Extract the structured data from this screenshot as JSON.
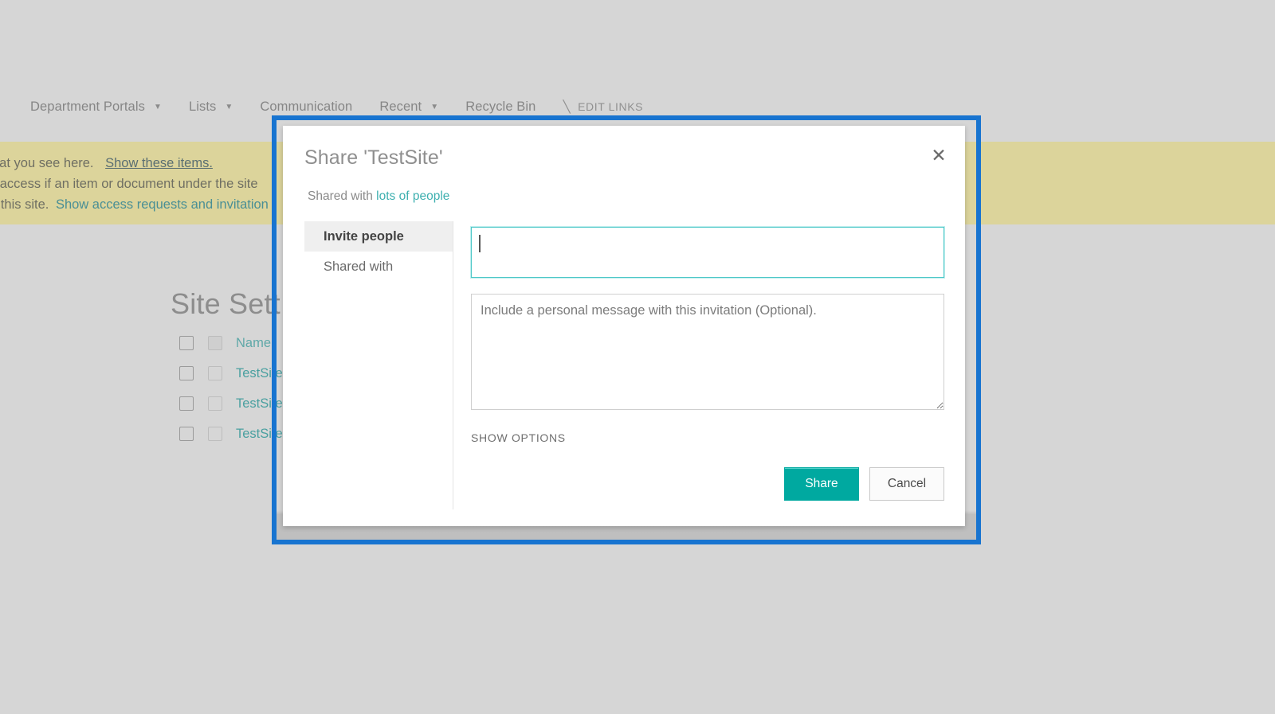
{
  "background": {
    "nav": {
      "items": [
        {
          "label": "Department Portals",
          "has_caret": true
        },
        {
          "label": "Lists",
          "has_caret": true
        },
        {
          "label": "Communication",
          "has_caret": false
        },
        {
          "label": "Recent",
          "has_caret": true
        },
        {
          "label": "Recycle Bin",
          "has_caret": false
        }
      ],
      "edit_links_label": "EDIT LINKS",
      "pencil_icon": "pencil-icon"
    },
    "banner": {
      "line1_text": "hat you see here.",
      "line1_link": "Show these items.",
      "line2_text": "d access if an item or document under the site",
      "line3_text": "s this site.",
      "line3_link": "Show access requests and invitation",
      "color": "#dcd49b"
    },
    "page_title": "Site Sett",
    "list": {
      "header_label": "Name",
      "rows": [
        "TestSite",
        "TestSite",
        "TestSite"
      ]
    }
  },
  "highlight": {
    "color": "#1874d0"
  },
  "dialog": {
    "title": "Share 'TestSite'",
    "close_icon": "✕",
    "shared_with_prefix": "Shared with",
    "shared_with_link": "lots of people",
    "nav": [
      {
        "label": "Invite people",
        "active": true
      },
      {
        "label": "Shared with",
        "active": false
      }
    ],
    "invite_input": {
      "value": "",
      "placeholder": ""
    },
    "personal_message": {
      "value": "",
      "placeholder": "Include a personal message with this invitation (Optional)."
    },
    "show_options_label": "SHOW OPTIONS",
    "share_button_label": "Share",
    "cancel_button_label": "Cancel",
    "accent_color": "#00a9a0",
    "link_color": "#3eb0b0"
  }
}
